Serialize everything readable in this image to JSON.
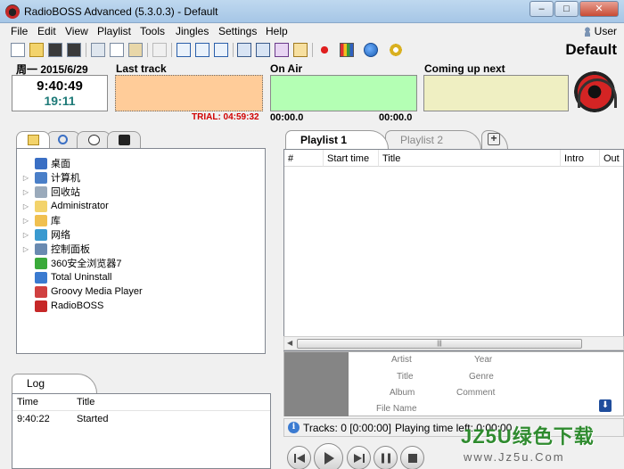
{
  "window": {
    "title": "RadioBOSS Advanced (5.3.0.3) - Default",
    "minimize": "–",
    "maximize": "□",
    "close": "✕"
  },
  "menu": {
    "items": [
      "File",
      "Edit",
      "View",
      "Playlist",
      "Tools",
      "Jingles",
      "Settings",
      "Help"
    ],
    "user": "User"
  },
  "toolbar": {
    "icons": [
      "new-icon",
      "open-icon",
      "save-icon",
      "save-as-icon",
      "cut-icon",
      "copy-icon",
      "paste-icon",
      "undo-icon",
      "layout-1-icon",
      "layout-2-icon",
      "layout-3-icon",
      "add-track-icon",
      "add-playlist-icon",
      "add-folder-icon",
      "add-url-icon",
      "record-icon",
      "equalizer-icon",
      "globe-icon",
      "settings-icon"
    ]
  },
  "profile": "Default",
  "status": {
    "date": "周一 2015/6/29",
    "time": "9:40:49",
    "remaining": "19:11",
    "last_track_label": "Last track",
    "on_air_label": "On Air",
    "coming_up_label": "Coming up next",
    "trial": "TRIAL: 04:59:32",
    "elapsed": "00:00.0",
    "left": "00:00.0",
    "colors": {
      "last_track": "#ffcc99",
      "on_air": "#b4ffb4",
      "coming_up": "#efefc2",
      "trial": "#d00000",
      "remaining": "#1e7a78"
    }
  },
  "explorer": {
    "tabs": [
      "folder-icon",
      "search-icon",
      "clock-icon",
      "device-icon"
    ],
    "items": [
      {
        "label": "桌面",
        "icon": "desktop-icon",
        "expandable": false
      },
      {
        "label": "计算机",
        "icon": "computer-icon",
        "expandable": true
      },
      {
        "label": "回收站",
        "icon": "recycle-bin-icon",
        "expandable": true
      },
      {
        "label": "Administrator",
        "icon": "user-folder-icon",
        "expandable": true
      },
      {
        "label": "库",
        "icon": "library-icon",
        "expandable": true
      },
      {
        "label": "网络",
        "icon": "network-icon",
        "expandable": true
      },
      {
        "label": "控制面板",
        "icon": "control-panel-icon",
        "expandable": true
      },
      {
        "label": "360安全浏览器7",
        "icon": "browser-icon",
        "expandable": false
      },
      {
        "label": "Total Uninstall",
        "icon": "uninstall-icon",
        "expandable": false
      },
      {
        "label": "Groovy Media Player",
        "icon": "media-player-icon",
        "expandable": false
      },
      {
        "label": "RadioBOSS",
        "icon": "radioboss-icon",
        "expandable": false
      }
    ]
  },
  "log": {
    "tab": "Log",
    "columns": [
      "Time",
      "Title"
    ],
    "rows": [
      {
        "time": "9:40:22",
        "title": "Started"
      }
    ]
  },
  "playlist": {
    "tabs": [
      "Playlist 1",
      "Playlist 2"
    ],
    "columns": [
      "#",
      "Start time",
      "Title",
      "Intro",
      "Out"
    ]
  },
  "track_info": {
    "artist": "Artist",
    "year": "Year",
    "title": "Title",
    "genre": "Genre",
    "album": "Album",
    "comment": "Comment",
    "file_name": "File Name"
  },
  "statusbar": {
    "tracks": "Tracks: 0 [0:00:00]",
    "playing_time_left": "Playing time left: 0:00:00"
  },
  "watermark": {
    "brand": "JZ5U绿色下载",
    "url": "www.Jz5u.Com"
  }
}
